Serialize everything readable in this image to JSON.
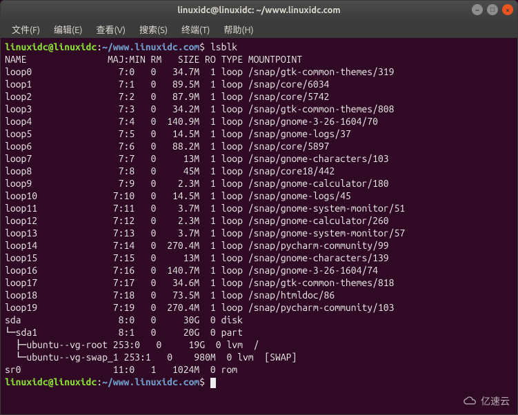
{
  "titlebar": {
    "title": "linuxidc@linuxidc: ~/www.linuxidc.com"
  },
  "menubar": {
    "items": [
      "文件(F)",
      "编辑(E)",
      "查看(V)",
      "搜索(S)",
      "终端(T)",
      "帮助(H)"
    ]
  },
  "prompt": {
    "user_host": "linuxidc@linuxidc",
    "colon": ":",
    "path": "~/www.linuxidc.com",
    "dollar": "$"
  },
  "command": "lsblk",
  "header": "NAME               MAJ:MIN RM   SIZE RO TYPE MOUNTPOINT",
  "rows": [
    {
      "name": "loop0",
      "maj": "7:0",
      "rm": "0",
      "size": "34.7M",
      "ro": "1",
      "type": "loop",
      "mnt": "/snap/gtk-common-themes/319"
    },
    {
      "name": "loop1",
      "maj": "7:1",
      "rm": "0",
      "size": "89.5M",
      "ro": "1",
      "type": "loop",
      "mnt": "/snap/core/6034"
    },
    {
      "name": "loop2",
      "maj": "7:2",
      "rm": "0",
      "size": "87.9M",
      "ro": "1",
      "type": "loop",
      "mnt": "/snap/core/5742"
    },
    {
      "name": "loop3",
      "maj": "7:3",
      "rm": "0",
      "size": "34.2M",
      "ro": "1",
      "type": "loop",
      "mnt": "/snap/gtk-common-themes/808"
    },
    {
      "name": "loop4",
      "maj": "7:4",
      "rm": "0",
      "size": "140.9M",
      "ro": "1",
      "type": "loop",
      "mnt": "/snap/gnome-3-26-1604/70"
    },
    {
      "name": "loop5",
      "maj": "7:5",
      "rm": "0",
      "size": "14.5M",
      "ro": "1",
      "type": "loop",
      "mnt": "/snap/gnome-logs/37"
    },
    {
      "name": "loop6",
      "maj": "7:6",
      "rm": "0",
      "size": "88.2M",
      "ro": "1",
      "type": "loop",
      "mnt": "/snap/core/5897"
    },
    {
      "name": "loop7",
      "maj": "7:7",
      "rm": "0",
      "size": "13M",
      "ro": "1",
      "type": "loop",
      "mnt": "/snap/gnome-characters/103"
    },
    {
      "name": "loop8",
      "maj": "7:8",
      "rm": "0",
      "size": "45M",
      "ro": "1",
      "type": "loop",
      "mnt": "/snap/core18/442"
    },
    {
      "name": "loop9",
      "maj": "7:9",
      "rm": "0",
      "size": "2.3M",
      "ro": "1",
      "type": "loop",
      "mnt": "/snap/gnome-calculator/180"
    },
    {
      "name": "loop10",
      "maj": "7:10",
      "rm": "0",
      "size": "14.5M",
      "ro": "1",
      "type": "loop",
      "mnt": "/snap/gnome-logs/45"
    },
    {
      "name": "loop11",
      "maj": "7:11",
      "rm": "0",
      "size": "3.7M",
      "ro": "1",
      "type": "loop",
      "mnt": "/snap/gnome-system-monitor/51"
    },
    {
      "name": "loop12",
      "maj": "7:12",
      "rm": "0",
      "size": "2.3M",
      "ro": "1",
      "type": "loop",
      "mnt": "/snap/gnome-calculator/260"
    },
    {
      "name": "loop13",
      "maj": "7:13",
      "rm": "0",
      "size": "3.7M",
      "ro": "1",
      "type": "loop",
      "mnt": "/snap/gnome-system-monitor/57"
    },
    {
      "name": "loop14",
      "maj": "7:14",
      "rm": "0",
      "size": "270.4M",
      "ro": "1",
      "type": "loop",
      "mnt": "/snap/pycharm-community/99"
    },
    {
      "name": "loop15",
      "maj": "7:15",
      "rm": "0",
      "size": "13M",
      "ro": "1",
      "type": "loop",
      "mnt": "/snap/gnome-characters/139"
    },
    {
      "name": "loop16",
      "maj": "7:16",
      "rm": "0",
      "size": "140.7M",
      "ro": "1",
      "type": "loop",
      "mnt": "/snap/gnome-3-26-1604/74"
    },
    {
      "name": "loop17",
      "maj": "7:17",
      "rm": "0",
      "size": "34.6M",
      "ro": "1",
      "type": "loop",
      "mnt": "/snap/gtk-common-themes/818"
    },
    {
      "name": "loop18",
      "maj": "7:18",
      "rm": "0",
      "size": "73.5M",
      "ro": "1",
      "type": "loop",
      "mnt": "/snap/htmldoc/86"
    },
    {
      "name": "loop19",
      "maj": "7:19",
      "rm": "0",
      "size": "270.4M",
      "ro": "1",
      "type": "loop",
      "mnt": "/snap/pycharm-community/103"
    },
    {
      "name": "sda",
      "maj": "8:0",
      "rm": "0",
      "size": "30G",
      "ro": "0",
      "type": "disk",
      "mnt": ""
    },
    {
      "name": "└─sda1",
      "maj": "8:1",
      "rm": "0",
      "size": "20G",
      "ro": "0",
      "type": "part",
      "mnt": ""
    },
    {
      "name": "  ├─ubuntu--vg-root",
      "maj": "253:0",
      "rm": "0",
      "size": "19G",
      "ro": "0",
      "type": "lvm",
      "mnt": "/"
    },
    {
      "name": "  └─ubuntu--vg-swap_1",
      "maj": "253:1",
      "rm": "0",
      "size": "980M",
      "ro": "0",
      "type": "lvm",
      "mnt": "[SWAP]"
    },
    {
      "name": "sr0",
      "maj": "11:0",
      "rm": "1",
      "size": "1024M",
      "ro": "0",
      "type": "rom",
      "mnt": ""
    }
  ],
  "watermark": "亿速云"
}
